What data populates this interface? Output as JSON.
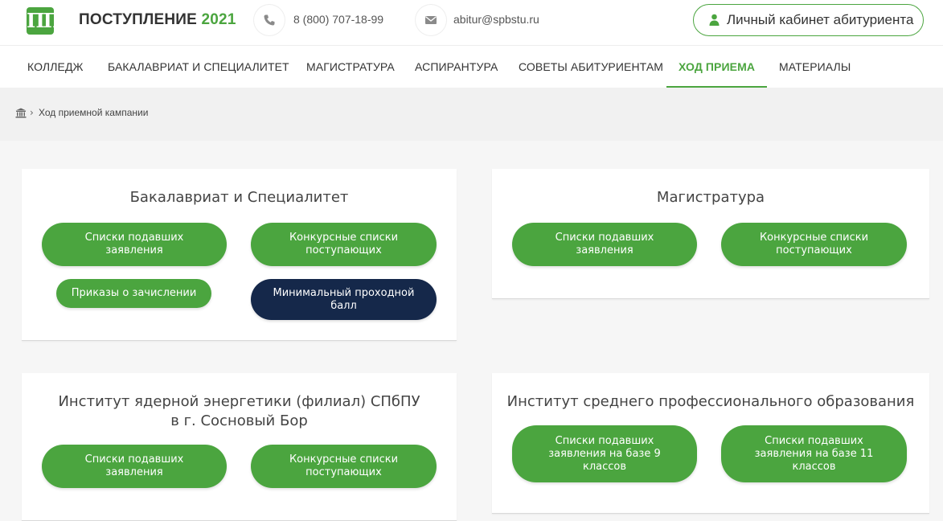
{
  "header": {
    "title_main": "ПОСТУПЛЕНИЕ",
    "title_year": "2021",
    "logo_glyph": "ПП",
    "phone": "8 (800) 707-18-99",
    "email": "abitur@spbstu.ru",
    "cabinet_label": "Личный кабинет абитуриента"
  },
  "nav": {
    "items": [
      {
        "label": "КОЛЛЕДЖ"
      },
      {
        "label": "БАКАЛАВРИАТ И СПЕЦИАЛИТЕТ"
      },
      {
        "label": "МАГИСТРАТУРА"
      },
      {
        "label": "АСПИРАНТУРА"
      },
      {
        "label": "СОВЕТЫ АБИТУРИЕНТАМ"
      },
      {
        "label": "ХОД ПРИЕМА"
      },
      {
        "label": "МАТЕРИАЛЫ"
      }
    ],
    "active": "ХОД ПРИЕМА"
  },
  "breadcrumb": {
    "separator": "›",
    "current": "Ход приемной кампании"
  },
  "cards": [
    {
      "title": "Бакалавриат и Специалитет",
      "buttons": [
        {
          "label": "Списки подавших заявления"
        },
        {
          "label": "Конкурсные списки поступающих"
        },
        {
          "label": "Приказы о зачислении"
        },
        {
          "label": "Минимальный проходной балл"
        }
      ]
    },
    {
      "title": "Магистратура",
      "buttons": [
        {
          "label": "Списки подавших заявления"
        },
        {
          "label": "Конкурсные списки поступающих"
        }
      ]
    },
    {
      "title": "Институт ядерной энергетики (филиал) СПбПУ в г. Сосновый Бор",
      "buttons": [
        {
          "label": "Списки подавших заявления"
        },
        {
          "label": "Конкурсные списки поступающих"
        }
      ]
    },
    {
      "title": "Институт среднего профессионального образования",
      "buttons": [
        {
          "label": "Списки подавших заявления на базе 9 классов"
        },
        {
          "label": "Списки подавших заявления на базе 11 классов"
        }
      ]
    }
  ],
  "colors": {
    "brand_green": "#4ba53f",
    "dark_navy": "#15284a"
  }
}
